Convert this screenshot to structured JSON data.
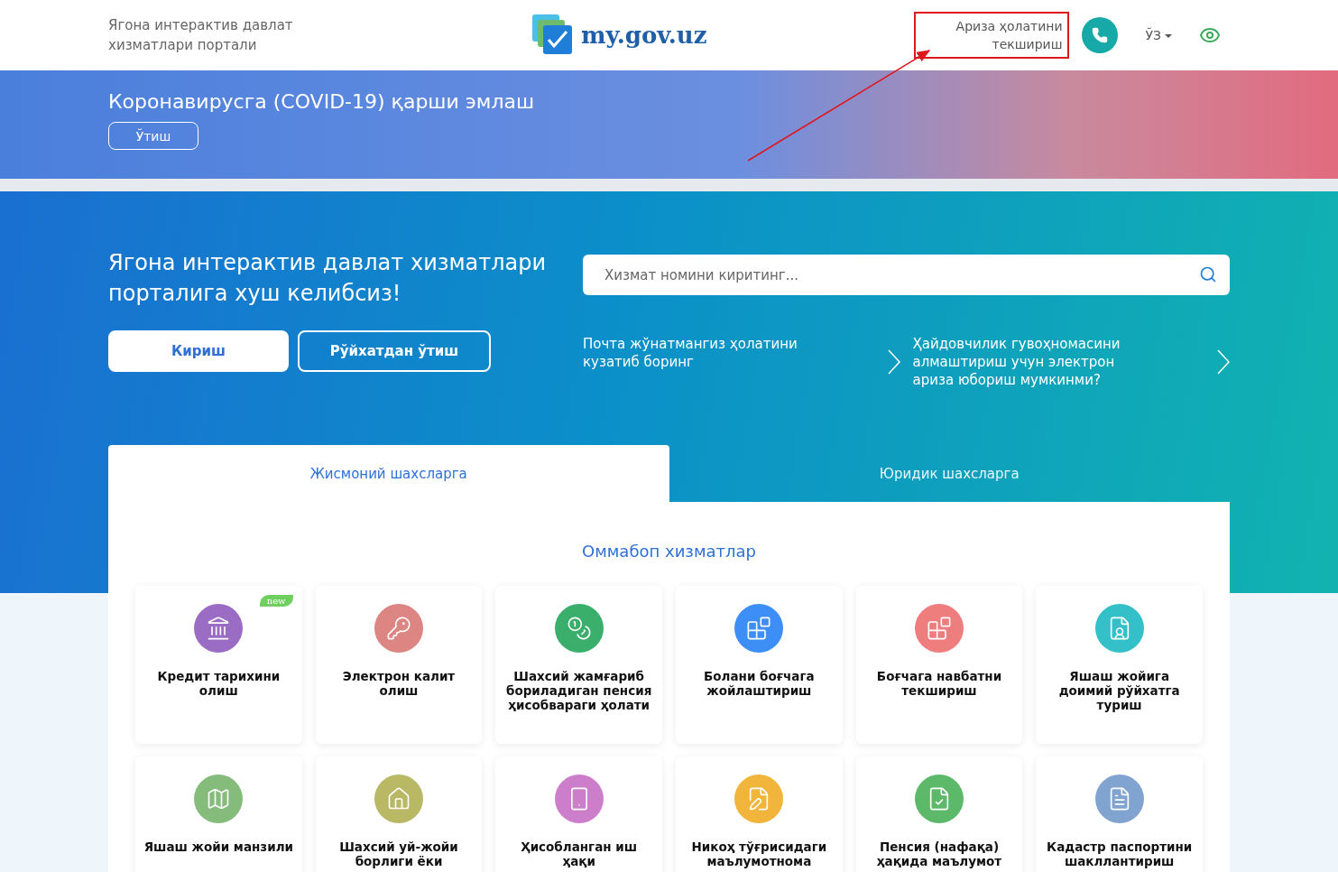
{
  "header": {
    "tagline": "Ягона интерактив давлат хизматлари портали",
    "logo": "my.gov.uz",
    "status_link": "Ариза ҳолатини текшириш",
    "language": "ЎЗ"
  },
  "banner": {
    "title": "Коронавирусга (COVID-19) қарши эмлаш",
    "button": "Ўтиш"
  },
  "hero": {
    "title": "Ягона интерактив давлат хизматлари порталига хуш келибсиз!",
    "login_button": "Кириш",
    "register_button": "Рўйхатдан ўтиш",
    "search": {
      "placeholder": "Хизмат номини киритинг..."
    },
    "links": [
      "Почта жўнатмангиз ҳолатини кузатиб боринг",
      "Ҳайдовчилик гувоҳномасини алмаштириш учун электрон ариза юбориш мумкинми?"
    ]
  },
  "tabs": [
    {
      "label": "Жисмоний шахсларга",
      "selected": true
    },
    {
      "label": "Юридик шахсларга",
      "selected": false
    }
  ],
  "section_title": "Оммабоп хизматлар",
  "services": [
    {
      "title": "Кредит тарихини олиш",
      "color": "#9b6cc4",
      "badge": "new"
    },
    {
      "title": "Электрон калит олиш",
      "color": "#dc8583"
    },
    {
      "title": "Шахсий жамғариб бориладиган пенсия ҳисобвараги ҳолати",
      "color": "#3aaf6c"
    },
    {
      "title": "Болани боғчага жойлаштириш",
      "color": "#3e8ef7"
    },
    {
      "title": "Боғчага навбатни текшириш",
      "color": "#ee7e7e"
    },
    {
      "title": "Яшаш жойига доимий рўйхатга туриш",
      "color": "#33c0c8"
    },
    {
      "title": "Яшаш жойи манзили",
      "color": "#85bb7b"
    },
    {
      "title": "Шахсий уй-жойи борлиги ёки",
      "color": "#b9b865"
    },
    {
      "title": "Ҳисобланган иш ҳақи",
      "color": "#cd7ecb"
    },
    {
      "title": "Никоҳ тўғрисидаги маълумотнома",
      "color": "#f0b53a"
    },
    {
      "title": "Пенсия (нафақа) ҳақида маълумот",
      "color": "#5db96a"
    },
    {
      "title": "Кадастр паспортини шакллантириш",
      "color": "#81a3cf"
    }
  ]
}
